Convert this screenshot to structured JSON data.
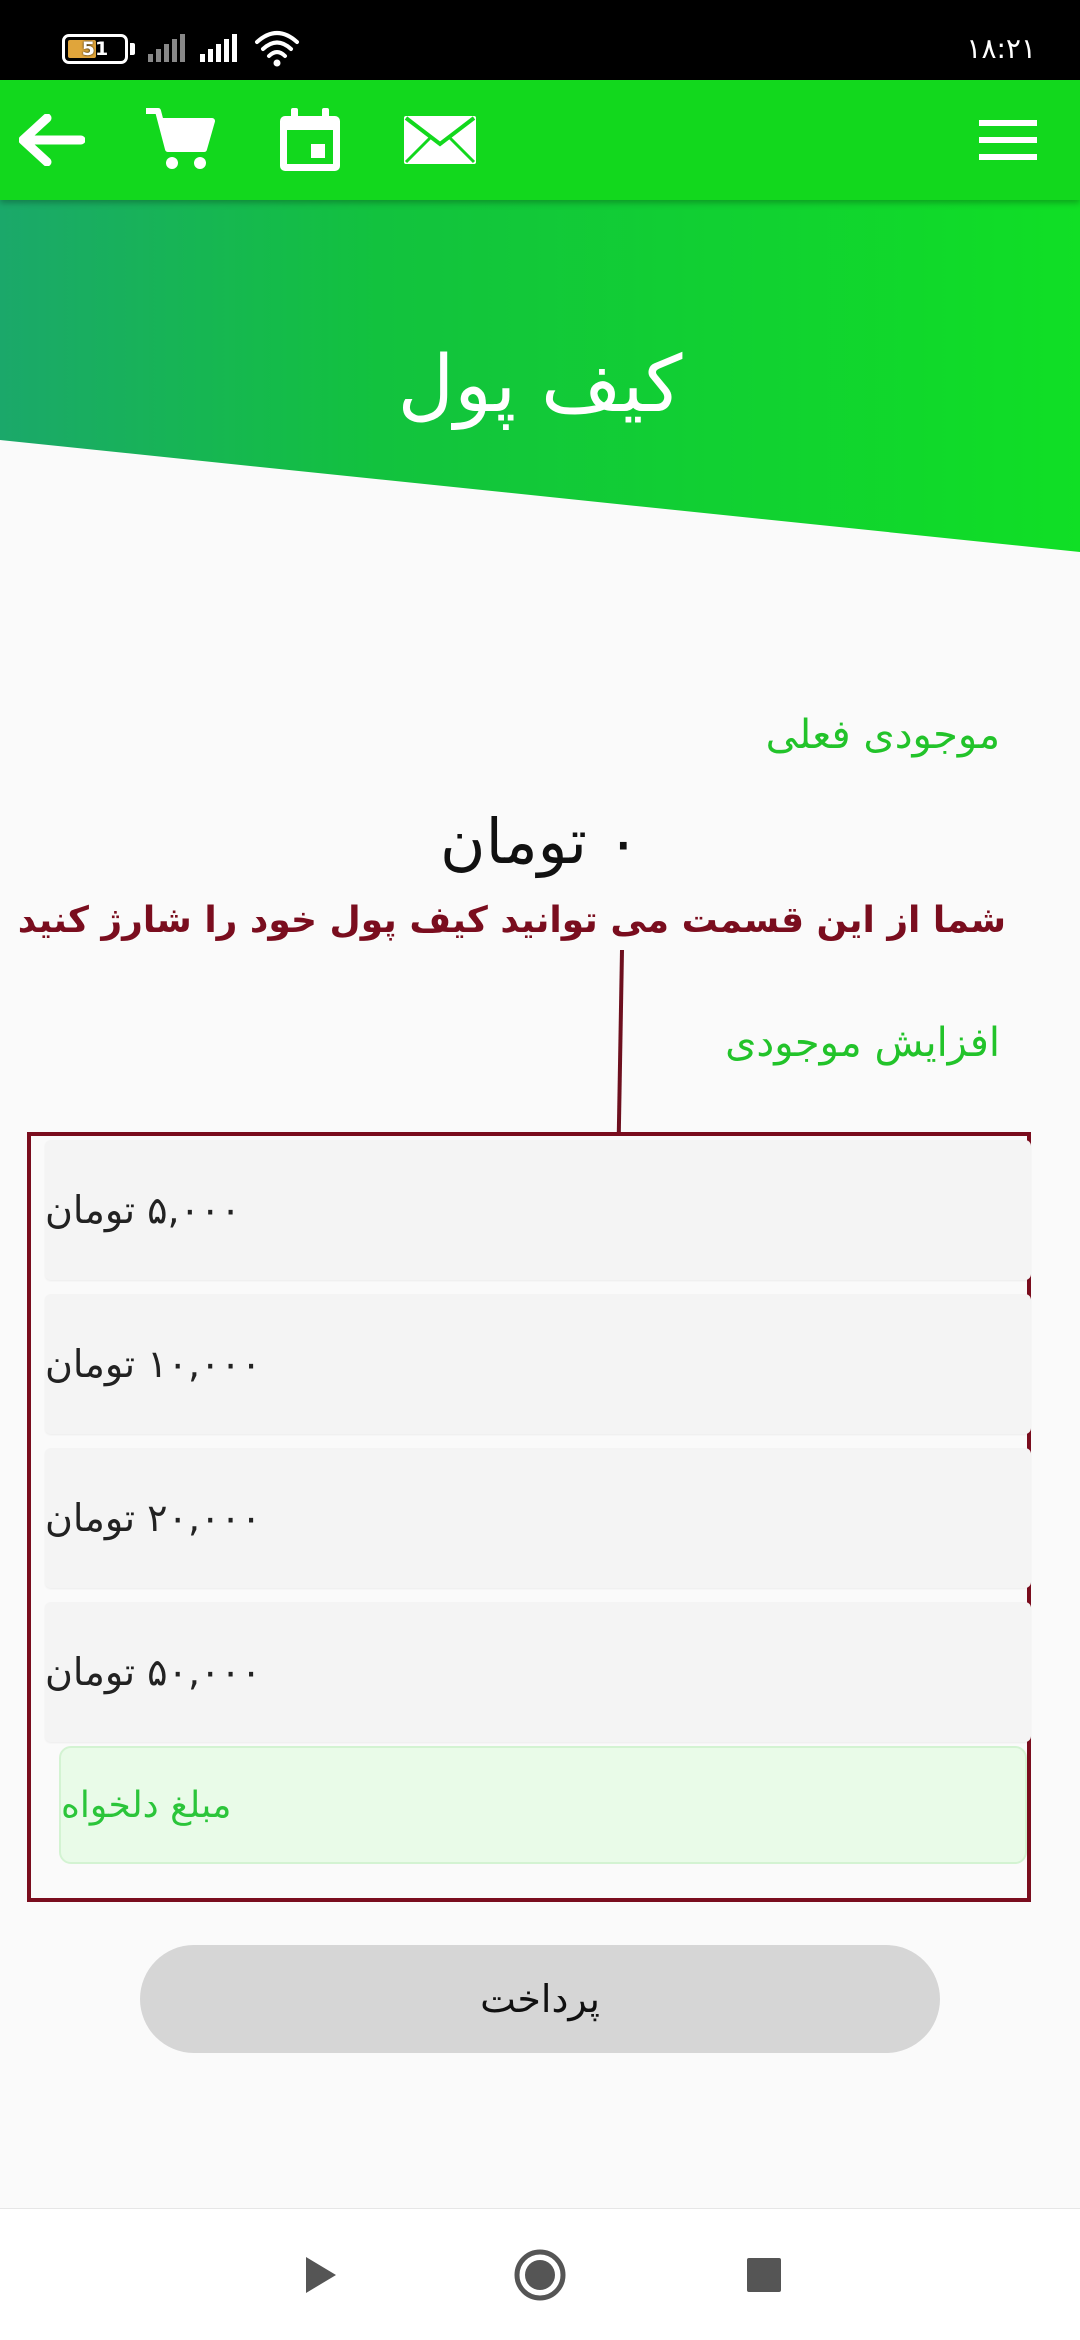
{
  "status_bar": {
    "battery_level": "51",
    "battery_fraction": 0.51,
    "time": "۱۸:۲۱"
  },
  "app_bar": {
    "icons": [
      "back-arrow-icon",
      "cart-icon",
      "calendar-icon",
      "mail-icon",
      "menu-icon"
    ]
  },
  "hero": {
    "title": "کیف پول"
  },
  "wallet": {
    "current_balance_label": "موجودی فعلی",
    "balance_value": "۰ تومان",
    "hint": "شما از این قسمت می توانید کیف پول خود را شارژ کنید",
    "increase_label": "افزایش موجودی"
  },
  "options": [
    {
      "label": "۵,۰۰۰ تومان"
    },
    {
      "label": "۱۰,۰۰۰ تومان"
    },
    {
      "label": "۲۰,۰۰۰ تومان"
    },
    {
      "label": "۵۰,۰۰۰ تومان"
    }
  ],
  "custom_amount_label": "مبلغ دلخواه",
  "pay_button_label": "پرداخت",
  "colors": {
    "accent_green": "#12d81d",
    "label_green": "#22c32a",
    "hint_red": "#7a0d1e"
  }
}
